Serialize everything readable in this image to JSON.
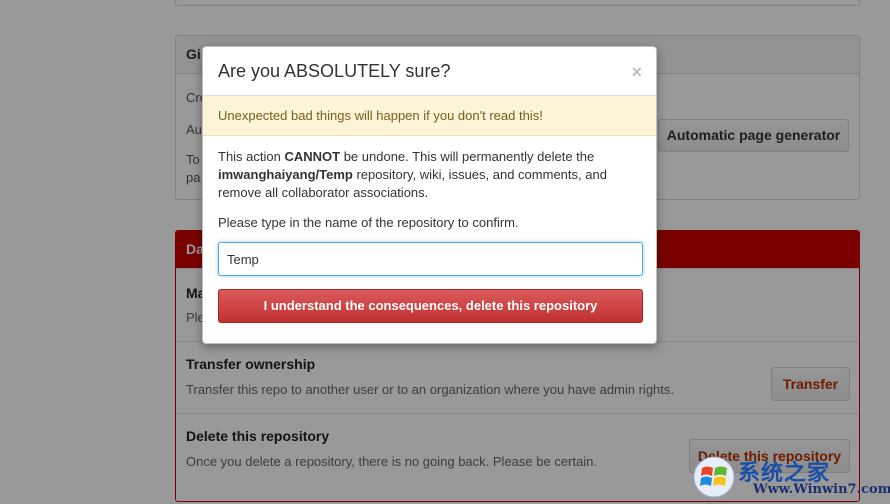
{
  "background": {
    "pages_box": {
      "header_label": "Gi",
      "lines": [
        "Cre",
        "Au",
        "To",
        "pa"
      ],
      "auto_page_button": "Automatic page generator"
    },
    "danger_zone": {
      "header_label": "Da",
      "rows": [
        {
          "title": "Ma",
          "desc": "Ple"
        },
        {
          "title": "Transfer ownership",
          "desc": "Transfer this repo to another user or to an organization where you have admin rights.",
          "button": "Transfer"
        },
        {
          "title": "Delete this repository",
          "desc": "Once you delete a repository, there is no going back. Please be certain.",
          "button": "Delete this repository"
        }
      ]
    }
  },
  "modal": {
    "title": "Are you ABSOLUTELY sure?",
    "close_glyph": "×",
    "warning": "Unexpected bad things will happen if you don't read this!",
    "body": {
      "p1": "This action ",
      "p1_strong": "CANNOT",
      "p2": " be undone. This will permanently delete the ",
      "repo": "imwanghaiyang/Temp",
      "p3": " repository, wiki, issues, and comments, and remove all collaborator associations."
    },
    "confirm_label": "Please type in the name of the repository to confirm.",
    "input_value": "Temp",
    "confirm_button": "I understand the consequences, delete this repository"
  },
  "watermark": {
    "cn": "系统之家",
    "en": "Www.Winwin7.com"
  },
  "colors": {
    "danger_red": "#cc0000",
    "warning_bg": "#fcf4d7",
    "input_focus": "#51a7e8"
  }
}
